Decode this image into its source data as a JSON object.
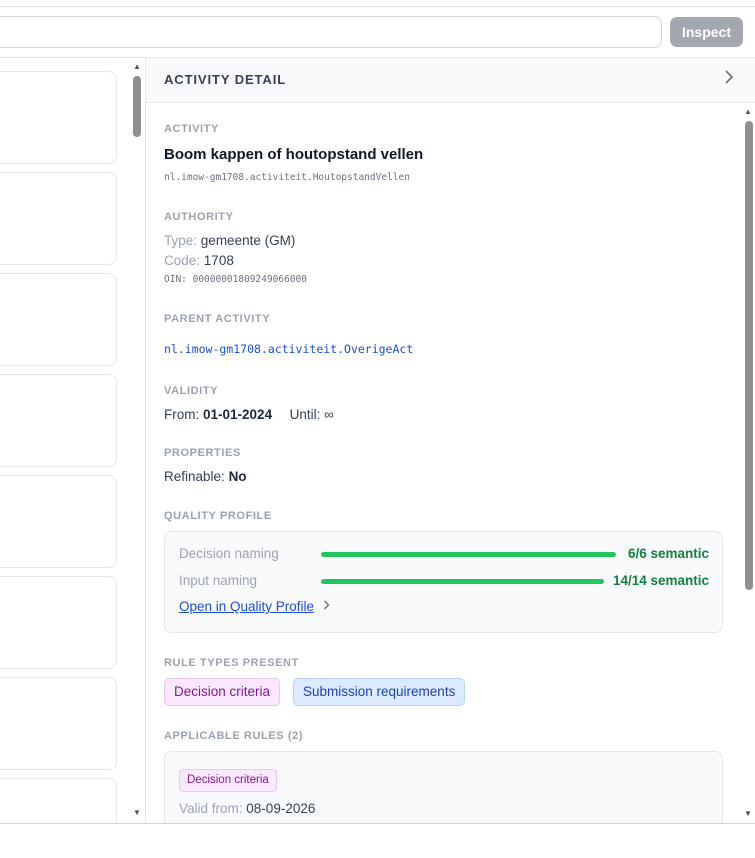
{
  "search": {
    "value": "",
    "placeholder": ""
  },
  "toolbar": {
    "inspect_label": "Inspect"
  },
  "detail": {
    "header_title": "ACTIVITY DETAIL",
    "activity": {
      "label": "ACTIVITY",
      "name": "Boom kappen of houtopstand vellen",
      "id": "nl.imow-gm1708.activiteit.HoutopstandVellen"
    },
    "authority": {
      "label": "AUTHORITY",
      "type_key": "Type:",
      "type_value": "gemeente (GM)",
      "code_key": "Code:",
      "code_value": "1708",
      "oin": "OIN: 00000001809249066000"
    },
    "parent": {
      "label": "PARENT ACTIVITY",
      "link": "nl.imow-gm1708.activiteit.OverigeAct"
    },
    "validity": {
      "label": "VALIDITY",
      "from_key": "From:",
      "from_value": "01-01-2024",
      "until_key": "Until:",
      "until_value": "∞"
    },
    "properties": {
      "label": "PROPERTIES",
      "refinable_key": "Refinable:",
      "refinable_value": "No"
    },
    "quality": {
      "label": "QUALITY PROFILE",
      "rows": [
        {
          "name": "Decision naming",
          "value": "6/6 semantic",
          "fraction": 1.0
        },
        {
          "name": "Input naming",
          "value": "14/14 semantic",
          "fraction": 1.0
        }
      ],
      "link": "Open in Quality Profile"
    },
    "rule_types": {
      "label": "RULE TYPES PRESENT",
      "tags": [
        "Decision criteria",
        "Submission requirements"
      ]
    },
    "rules": {
      "label": "APPLICABLE RULES (2)",
      "first_tag": "Decision criteria",
      "valid_key": "Valid from:",
      "valid_value": "08-09-2026"
    }
  },
  "colors": {
    "accent_green": "#22c55e",
    "link_blue": "#1d4ed8",
    "decision_purple": "#86198f",
    "submission_blue": "#1e40af",
    "inspect_disabled": "#a3a8b0"
  },
  "icons": [
    "chevron-right-icon",
    "scroll-up-arrow-icon",
    "scroll-down-arrow-icon"
  ]
}
